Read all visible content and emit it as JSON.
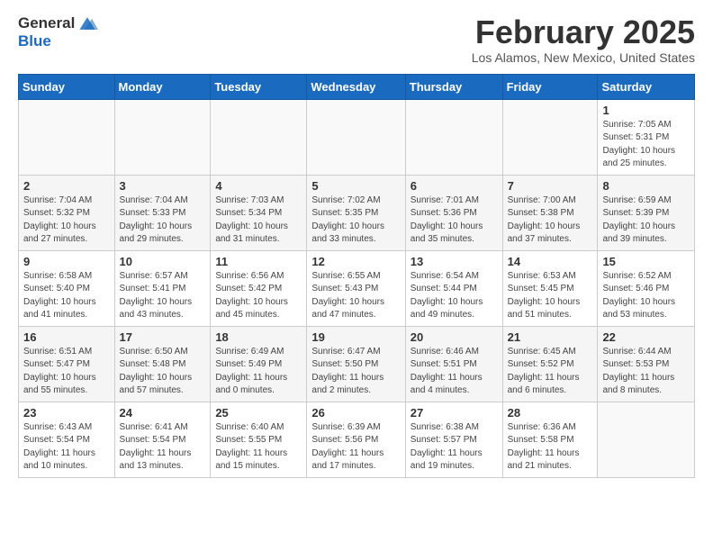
{
  "header": {
    "logo_general": "General",
    "logo_blue": "Blue",
    "month_title": "February 2025",
    "location": "Los Alamos, New Mexico, United States"
  },
  "days_of_week": [
    "Sunday",
    "Monday",
    "Tuesday",
    "Wednesday",
    "Thursday",
    "Friday",
    "Saturday"
  ],
  "weeks": [
    [
      {
        "day": "",
        "info": ""
      },
      {
        "day": "",
        "info": ""
      },
      {
        "day": "",
        "info": ""
      },
      {
        "day": "",
        "info": ""
      },
      {
        "day": "",
        "info": ""
      },
      {
        "day": "",
        "info": ""
      },
      {
        "day": "1",
        "info": "Sunrise: 7:05 AM\nSunset: 5:31 PM\nDaylight: 10 hours\nand 25 minutes."
      }
    ],
    [
      {
        "day": "2",
        "info": "Sunrise: 7:04 AM\nSunset: 5:32 PM\nDaylight: 10 hours\nand 27 minutes."
      },
      {
        "day": "3",
        "info": "Sunrise: 7:04 AM\nSunset: 5:33 PM\nDaylight: 10 hours\nand 29 minutes."
      },
      {
        "day": "4",
        "info": "Sunrise: 7:03 AM\nSunset: 5:34 PM\nDaylight: 10 hours\nand 31 minutes."
      },
      {
        "day": "5",
        "info": "Sunrise: 7:02 AM\nSunset: 5:35 PM\nDaylight: 10 hours\nand 33 minutes."
      },
      {
        "day": "6",
        "info": "Sunrise: 7:01 AM\nSunset: 5:36 PM\nDaylight: 10 hours\nand 35 minutes."
      },
      {
        "day": "7",
        "info": "Sunrise: 7:00 AM\nSunset: 5:38 PM\nDaylight: 10 hours\nand 37 minutes."
      },
      {
        "day": "8",
        "info": "Sunrise: 6:59 AM\nSunset: 5:39 PM\nDaylight: 10 hours\nand 39 minutes."
      }
    ],
    [
      {
        "day": "9",
        "info": "Sunrise: 6:58 AM\nSunset: 5:40 PM\nDaylight: 10 hours\nand 41 minutes."
      },
      {
        "day": "10",
        "info": "Sunrise: 6:57 AM\nSunset: 5:41 PM\nDaylight: 10 hours\nand 43 minutes."
      },
      {
        "day": "11",
        "info": "Sunrise: 6:56 AM\nSunset: 5:42 PM\nDaylight: 10 hours\nand 45 minutes."
      },
      {
        "day": "12",
        "info": "Sunrise: 6:55 AM\nSunset: 5:43 PM\nDaylight: 10 hours\nand 47 minutes."
      },
      {
        "day": "13",
        "info": "Sunrise: 6:54 AM\nSunset: 5:44 PM\nDaylight: 10 hours\nand 49 minutes."
      },
      {
        "day": "14",
        "info": "Sunrise: 6:53 AM\nSunset: 5:45 PM\nDaylight: 10 hours\nand 51 minutes."
      },
      {
        "day": "15",
        "info": "Sunrise: 6:52 AM\nSunset: 5:46 PM\nDaylight: 10 hours\nand 53 minutes."
      }
    ],
    [
      {
        "day": "16",
        "info": "Sunrise: 6:51 AM\nSunset: 5:47 PM\nDaylight: 10 hours\nand 55 minutes."
      },
      {
        "day": "17",
        "info": "Sunrise: 6:50 AM\nSunset: 5:48 PM\nDaylight: 10 hours\nand 57 minutes."
      },
      {
        "day": "18",
        "info": "Sunrise: 6:49 AM\nSunset: 5:49 PM\nDaylight: 11 hours\nand 0 minutes."
      },
      {
        "day": "19",
        "info": "Sunrise: 6:47 AM\nSunset: 5:50 PM\nDaylight: 11 hours\nand 2 minutes."
      },
      {
        "day": "20",
        "info": "Sunrise: 6:46 AM\nSunset: 5:51 PM\nDaylight: 11 hours\nand 4 minutes."
      },
      {
        "day": "21",
        "info": "Sunrise: 6:45 AM\nSunset: 5:52 PM\nDaylight: 11 hours\nand 6 minutes."
      },
      {
        "day": "22",
        "info": "Sunrise: 6:44 AM\nSunset: 5:53 PM\nDaylight: 11 hours\nand 8 minutes."
      }
    ],
    [
      {
        "day": "23",
        "info": "Sunrise: 6:43 AM\nSunset: 5:54 PM\nDaylight: 11 hours\nand 10 minutes."
      },
      {
        "day": "24",
        "info": "Sunrise: 6:41 AM\nSunset: 5:54 PM\nDaylight: 11 hours\nand 13 minutes."
      },
      {
        "day": "25",
        "info": "Sunrise: 6:40 AM\nSunset: 5:55 PM\nDaylight: 11 hours\nand 15 minutes."
      },
      {
        "day": "26",
        "info": "Sunrise: 6:39 AM\nSunset: 5:56 PM\nDaylight: 11 hours\nand 17 minutes."
      },
      {
        "day": "27",
        "info": "Sunrise: 6:38 AM\nSunset: 5:57 PM\nDaylight: 11 hours\nand 19 minutes."
      },
      {
        "day": "28",
        "info": "Sunrise: 6:36 AM\nSunset: 5:58 PM\nDaylight: 11 hours\nand 21 minutes."
      },
      {
        "day": "",
        "info": ""
      }
    ]
  ]
}
